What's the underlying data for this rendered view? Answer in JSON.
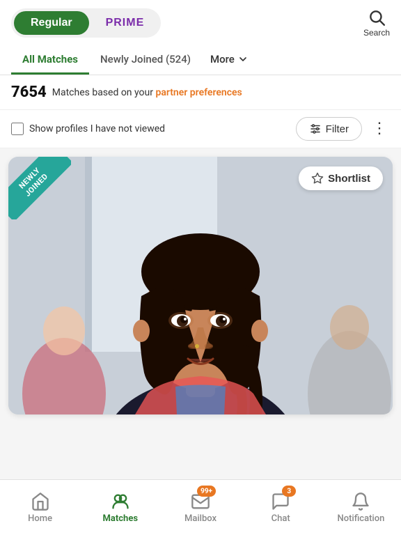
{
  "header": {
    "plan_regular": "Regular",
    "plan_prime": "PRIME",
    "search_label": "Search"
  },
  "tabs": {
    "all_matches": "All Matches",
    "newly_joined": "Newly Joined (524)",
    "more": "More"
  },
  "match_info": {
    "count": "7654",
    "text": "Matches based on your ",
    "pref_link": "partner preferences"
  },
  "filter_bar": {
    "checkbox_label": "Show profiles I have not viewed",
    "filter_btn": "Filter"
  },
  "profile_card": {
    "badge_line1": "NEWLY",
    "badge_line2": "JOINED",
    "shortlist_btn": "Shortlist"
  },
  "bottom_nav": {
    "home": "Home",
    "matches": "Matches",
    "mailbox": "Mailbox",
    "mailbox_badge": "99+",
    "chat": "Chat",
    "chat_badge": "3",
    "notification": "Notification"
  }
}
